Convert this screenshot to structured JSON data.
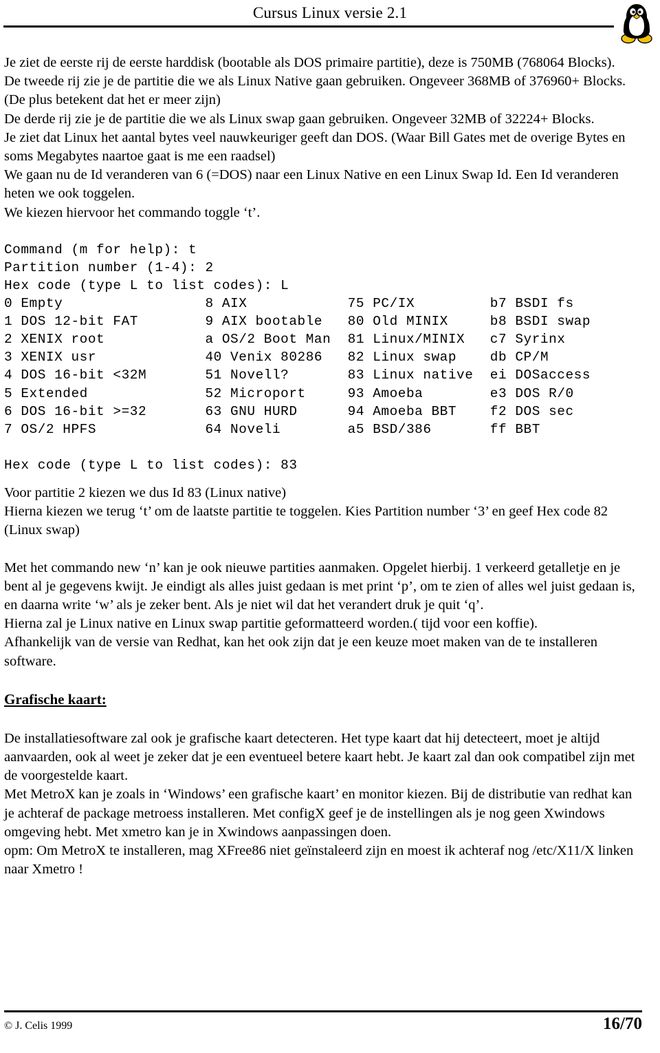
{
  "header": {
    "title": "Cursus Linux versie 2.1",
    "logo_icon": "tux-penguin-icon"
  },
  "body": {
    "paragraph_1": "Je ziet de eerste rij de eerste harddisk (bootable als DOS primaire partitie), deze is 750MB (768064 Blocks).",
    "paragraph_2": "De tweede rij zie je de partitie die we als Linux Native gaan gebruiken. Ongeveer 368MB of 376960+ Blocks. (De plus betekent dat het er meer zijn)",
    "paragraph_3": "De derde rij zie je de partitie die we als Linux swap gaan gebruiken. Ongeveer 32MB of 32224+ Blocks.",
    "paragraph_4": "Je ziet dat Linux het aantal bytes veel nauwkeuriger geeft dan DOS. (Waar Bill Gates met de overige Bytes en soms Megabytes naartoe gaat is me een raadsel)",
    "paragraph_5": "We gaan nu de Id veranderen van 6 (=DOS) naar een Linux Native en een Linux Swap Id. Een Id veranderen heten we ook toggelen.",
    "paragraph_6": "We kiezen hiervoor het commando toggle ‘t’.",
    "paragraph_7": "Voor partitie 2 kiezen we dus Id 83 (Linux native)",
    "paragraph_8": "Hierna kiezen we terug ‘t’ om de laatste partitie te toggelen. Kies Partition number ‘3’ en geef Hex code 82 (Linux swap)",
    "paragraph_9": "Met het commando new ‘n’ kan je ook nieuwe partities aanmaken. Opgelet hierbij. 1 verkeerd getalletje en je bent al je gegevens kwijt. Je eindigt als alles juist gedaan is met print ‘p’, om te zien of alles wel juist gedaan is, en daarna write ‘w’ als je zeker bent. Als je niet wil dat het verandert druk je quit ‘q’.",
    "paragraph_10": "Hierna zal je Linux native en Linux swap partitie geformatteerd worden.( tijd voor een koffie).",
    "paragraph_11": "Afhankelijk van de versie van Redhat, kan het ook zijn dat je een keuze moet maken van de te installeren software.",
    "section_heading": "Grafische kaart:",
    "paragraph_12": "De installatiesoftware zal ook je grafische kaart detecteren. Het type kaart dat hij detecteert, moet je altijd aanvaarden, ook al weet je zeker dat je een eventueel betere kaart hebt. Je kaart zal dan ook compatibel zijn met de voorgestelde kaart.",
    "paragraph_13": "Met MetroX kan je zoals in ‘Windows’ een grafische kaart’ en monitor kiezen. Bij de distributie van redhat kan je achteraf de package metroess installeren. Met configX geef je de instellingen als je nog geen Xwindows omgeving hebt. Met xmetro kan je in Xwindows aanpassingen doen.",
    "paragraph_14": "opm: Om MetroX te installeren, mag XFree86 niet geïnstaleerd zijn en moest ik achteraf nog /etc/X11/X linken naar Xmetro !"
  },
  "terminal": {
    "prompt_command": "Command (m for help): t",
    "prompt_partition": "Partition number (1-4): 2",
    "prompt_hexcode": "Hex code (type L to list codes): L",
    "prompt_hexcode_answer": "Hex code (type L to list codes): 83",
    "table_rows": [
      [
        "0 Empty",
        "8 AIX",
        "75 PC/IX",
        "b7 BSDI fs"
      ],
      [
        "1 DOS 12-bit FAT",
        "9 AIX bootable",
        "80 Old MINIX",
        "b8 BSDI swap"
      ],
      [
        "2 XENIX root",
        "a OS/2 Boot Man",
        "81 Linux/MINIX",
        "c7 Syrinx"
      ],
      [
        "3 XENIX usr",
        "40 Venix 80286",
        "82 Linux swap",
        "db CP/M"
      ],
      [
        "4 DOS 16-bit <32M",
        "51 Novell?",
        "83 Linux native",
        "ei DOSaccess"
      ],
      [
        "5 Extended",
        "52 Microport",
        "93 Amoeba",
        "e3 DOS R/0"
      ],
      [
        "6 DOS 16-bit >=32",
        "63 GNU HURD",
        "94 Amoeba BBT",
        "f2 DOS sec"
      ],
      [
        "7 OS/2 HPFS",
        "64 Noveli",
        "a5 BSD/386",
        "ff BBT"
      ]
    ],
    "column_starts": [
      0,
      24,
      41,
      58
    ]
  },
  "footer": {
    "copyright": "© J. Celis 1999",
    "page_number": "16/70"
  },
  "colors": {
    "text": "#000000",
    "background": "#ffffff",
    "rule": "#000000",
    "tux_body": "#000000",
    "tux_belly": "#ffffff",
    "tux_feet": "#f2c20a"
  }
}
